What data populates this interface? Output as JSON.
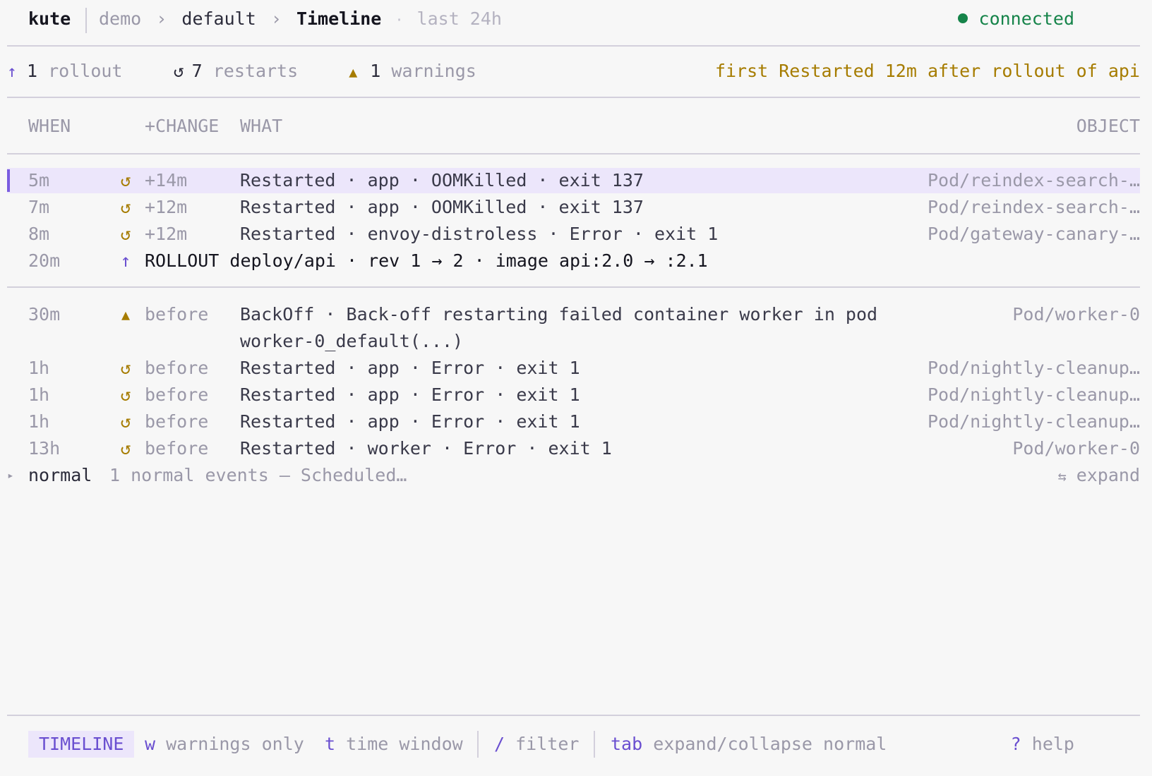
{
  "header": {
    "app_name": "kute",
    "breadcrumb": [
      "demo",
      "default",
      "Timeline"
    ],
    "breadcrumb_sep": "›",
    "window_sep": "·",
    "window": "last 24h",
    "status": "connected"
  },
  "summary": {
    "rollout_count": "1",
    "rollout_label": "rollout",
    "restart_count": "7",
    "restart_label": "restarts",
    "warning_count": "1",
    "warning_label": "warnings",
    "insight": "first Restarted 12m after rollout of api"
  },
  "columns": {
    "when": "WHEN",
    "change": "+CHANGE",
    "what": "WHAT",
    "object": "OBJECT"
  },
  "after_rows": [
    {
      "when": "5m",
      "change": "+14m",
      "what": "Restarted · app · OOMKilled · exit 137",
      "object": "Pod/reindex-search-…",
      "icon": "restart-icon"
    },
    {
      "when": "7m",
      "change": "+12m",
      "what": "Restarted · app · OOMKilled · exit 137",
      "object": "Pod/reindex-search-…",
      "icon": "restart-icon"
    },
    {
      "when": "8m",
      "change": "+12m",
      "what": "Restarted · envoy-distroless · Error · exit 1",
      "object": "Pod/gateway-canary-…",
      "icon": "restart-icon"
    }
  ],
  "rollout_row": {
    "when": "20m",
    "text": "ROLLOUT deploy/api · rev 1 → 2 · image api:2.0 → :2.1",
    "icon": "rollout-arrow-icon"
  },
  "before_rows": [
    {
      "when": "30m",
      "change": "before",
      "what": "BackOff · Back-off restarting failed container worker in pod",
      "what_cont": "worker-0_default(...)",
      "object": "Pod/worker-0",
      "icon": "warning-icon"
    },
    {
      "when": "1h",
      "change": "before",
      "what": "Restarted · app · Error · exit 1",
      "object": "Pod/nightly-cleanup…",
      "icon": "restart-icon"
    },
    {
      "when": "1h",
      "change": "before",
      "what": "Restarted · app · Error · exit 1",
      "object": "Pod/nightly-cleanup…",
      "icon": "restart-icon"
    },
    {
      "when": "1h",
      "change": "before",
      "what": "Restarted · app · Error · exit 1",
      "object": "Pod/nightly-cleanup…",
      "icon": "restart-icon"
    },
    {
      "when": "13h",
      "change": "before",
      "what": "Restarted · worker · Error · exit 1",
      "object": "Pod/worker-0",
      "icon": "restart-icon"
    }
  ],
  "normal_group": {
    "marker": "▸",
    "label": "normal",
    "summary": "1 normal events — Scheduled…",
    "expand_icon": "⇆",
    "expand_label": "expand"
  },
  "footer": {
    "mode": "TIMELINE",
    "keys": [
      {
        "key": "w",
        "label": "warnings only"
      },
      {
        "key": "t",
        "label": "time window"
      },
      {
        "key": "/",
        "label": "filter"
      },
      {
        "key": "tab",
        "label": "expand/collapse normal"
      }
    ],
    "help_key": "?",
    "help_label": "help"
  },
  "colors": {
    "accent": "#6a4fd0",
    "warning": "#a67c00",
    "connected": "#16844a",
    "selection": "#ece6fb"
  }
}
